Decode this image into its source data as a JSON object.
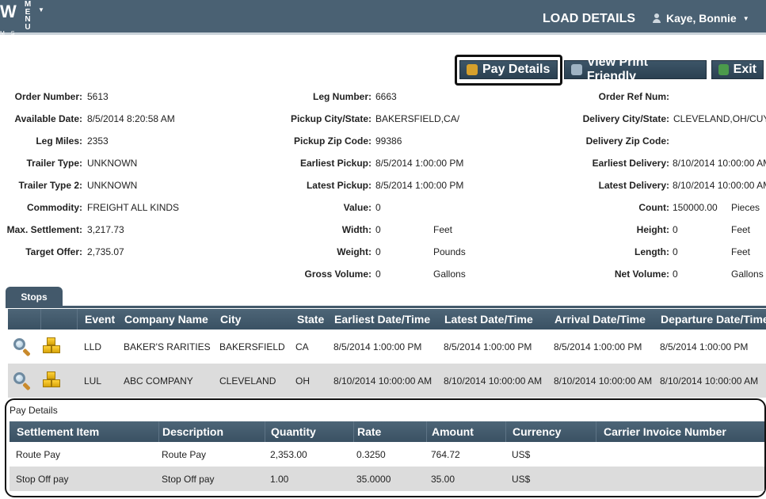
{
  "header": {
    "logo_text": "W",
    "logo_sub": "M S",
    "menu_label": "MENU",
    "page_title": "LOAD DETAILS",
    "user_name": "Kaye, Bonnie"
  },
  "toolbar": {
    "pay_details_label": "Pay Details",
    "view_print_label": "View Print Friendly",
    "exit_label": "Exit"
  },
  "details": {
    "order_number": {
      "label": "Order Number:",
      "value": "5613"
    },
    "available_date": {
      "label": "Available Date:",
      "value": "8/5/2014 8:20:58 AM"
    },
    "leg_miles": {
      "label": "Leg Miles:",
      "value": "2353"
    },
    "trailer_type": {
      "label": "Trailer Type:",
      "value": "UNKNOWN"
    },
    "trailer_type_2": {
      "label": "Trailer Type 2:",
      "value": "UNKNOWN"
    },
    "commodity": {
      "label": "Commodity:",
      "value": "FREIGHT ALL KINDS"
    },
    "max_settlement": {
      "label": "Max. Settlement:",
      "value": "3,217.73"
    },
    "target_offer": {
      "label": "Target Offer:",
      "value": "2,735.07"
    },
    "leg_number": {
      "label": "Leg Number:",
      "value": "6663"
    },
    "pickup_city_state": {
      "label": "Pickup City/State:",
      "value": "BAKERSFIELD,CA/"
    },
    "pickup_zip": {
      "label": "Pickup Zip Code:",
      "value": "99386"
    },
    "earliest_pickup": {
      "label": "Earliest Pickup:",
      "value": "8/5/2014 1:00:00 PM"
    },
    "latest_pickup": {
      "label": "Latest Pickup:",
      "value": "8/5/2014 1:00:00 PM"
    },
    "value": {
      "label": "Value:",
      "value": "0"
    },
    "width": {
      "label": "Width:",
      "value": "0",
      "unit": "Feet"
    },
    "weight": {
      "label": "Weight:",
      "value": "0",
      "unit": "Pounds"
    },
    "gross_volume": {
      "label": "Gross Volume:",
      "value": "0",
      "unit": "Gallons"
    },
    "order_ref_num": {
      "label": "Order Ref Num:",
      "value": ""
    },
    "delivery_city_state": {
      "label": "Delivery City/State:",
      "value": "CLEVELAND,OH/CUY"
    },
    "delivery_zip": {
      "label": "Delivery Zip Code:",
      "value": ""
    },
    "earliest_delivery": {
      "label": "Earliest Delivery:",
      "value": "8/10/2014 10:00:00 AM"
    },
    "latest_delivery": {
      "label": "Latest Delivery:",
      "value": "8/10/2014 10:00:00 AM"
    },
    "count": {
      "label": "Count:",
      "value": "150000.00",
      "unit": "Pieces"
    },
    "height": {
      "label": "Height:",
      "value": "0",
      "unit": "Feet"
    },
    "length": {
      "label": "Length:",
      "value": "0",
      "unit": "Feet"
    },
    "net_volume": {
      "label": "Net Volume:",
      "value": "0",
      "unit": "Gallons"
    }
  },
  "stops": {
    "tab_label": "Stops",
    "columns": [
      "Event",
      "Company Name",
      "City",
      "State",
      "Earliest Date/Time",
      "Latest Date/Time",
      "Arrival Date/Time",
      "Departure Date/Time"
    ],
    "rows": [
      [
        "LLD",
        "BAKER'S RARITIES",
        "BAKERSFIELD",
        "CA",
        "8/5/2014 1:00:00 PM",
        "8/5/2014 1:00:00 PM",
        "8/5/2014 1:00:00 PM",
        "8/5/2014 1:00:00 PM"
      ],
      [
        "LUL",
        "ABC COMPANY",
        "CLEVELAND",
        "OH",
        "8/10/2014 10:00:00 AM",
        "8/10/2014 10:00:00 AM",
        "8/10/2014 10:00:00 AM",
        "8/10/2014 10:00:00 AM"
      ]
    ]
  },
  "pay": {
    "title": "Pay Details",
    "columns": [
      "Settlement Item",
      "Description",
      "Quantity",
      "Rate",
      "Amount",
      "Currency",
      "Carrier Invoice Number"
    ],
    "rows": [
      [
        "Route Pay",
        "Route Pay",
        "2,353.00",
        "0.3250",
        "764.72",
        "US$",
        ""
      ],
      [
        "Stop Off pay",
        "Stop Off pay",
        "1.00",
        "35.0000",
        "35.00",
        "US$",
        ""
      ]
    ]
  },
  "icons": {
    "view": "magnifier-icon",
    "freight": "boxes-icon",
    "pay": "money-bag-icon",
    "print": "printer-icon",
    "exit": "exit-door-icon"
  }
}
